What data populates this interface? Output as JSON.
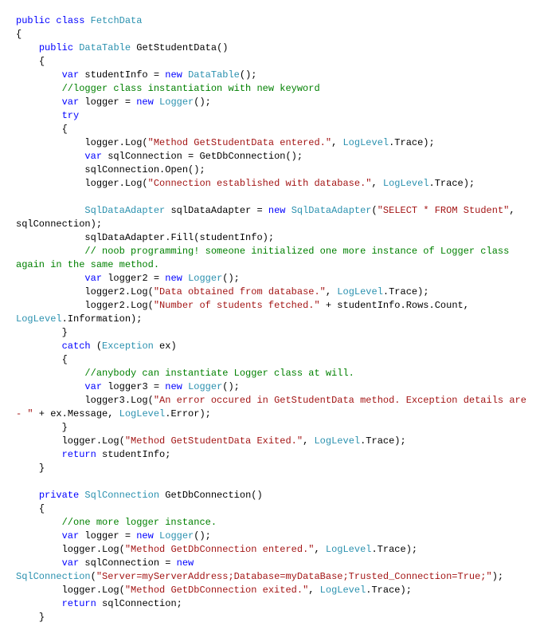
{
  "editor": {
    "language": "csharp",
    "background_color": "#FFFFFF",
    "font_size_px": 12,
    "line_height_px": 17,
    "word_wrap": true,
    "palette": {
      "keyword": "#0000FF",
      "type": "#2B91AF",
      "string": "#A31515",
      "comment": "#008000",
      "plain": "#000000"
    }
  },
  "code": {
    "lines": [
      [
        {
          "t": "kw",
          "s": "public "
        },
        {
          "t": "kw",
          "s": "class "
        },
        {
          "t": "typ",
          "s": "FetchData"
        }
      ],
      [
        {
          "t": "pln",
          "s": "{"
        }
      ],
      [
        {
          "t": "pln",
          "s": "    "
        },
        {
          "t": "kw",
          "s": "public "
        },
        {
          "t": "typ",
          "s": "DataTable "
        },
        {
          "t": "pln",
          "s": "GetStudentData()"
        }
      ],
      [
        {
          "t": "pln",
          "s": "    {"
        }
      ],
      [
        {
          "t": "pln",
          "s": "        "
        },
        {
          "t": "kw",
          "s": "var "
        },
        {
          "t": "pln",
          "s": "studentInfo = "
        },
        {
          "t": "kw",
          "s": "new "
        },
        {
          "t": "typ",
          "s": "DataTable"
        },
        {
          "t": "pln",
          "s": "();"
        }
      ],
      [
        {
          "t": "pln",
          "s": "        "
        },
        {
          "t": "cmt",
          "s": "//logger class instantiation with new keyword"
        }
      ],
      [
        {
          "t": "pln",
          "s": "        "
        },
        {
          "t": "kw",
          "s": "var "
        },
        {
          "t": "pln",
          "s": "logger = "
        },
        {
          "t": "kw",
          "s": "new "
        },
        {
          "t": "typ",
          "s": "Logger"
        },
        {
          "t": "pln",
          "s": "();"
        }
      ],
      [
        {
          "t": "pln",
          "s": "        "
        },
        {
          "t": "kw",
          "s": "try"
        }
      ],
      [
        {
          "t": "pln",
          "s": "        {"
        }
      ],
      [
        {
          "t": "pln",
          "s": "            logger.Log("
        },
        {
          "t": "str",
          "s": "\"Method GetStudentData entered.\""
        },
        {
          "t": "pln",
          "s": ", "
        },
        {
          "t": "typ",
          "s": "LogLevel"
        },
        {
          "t": "pln",
          "s": ".Trace);"
        }
      ],
      [
        {
          "t": "pln",
          "s": "            "
        },
        {
          "t": "kw",
          "s": "var "
        },
        {
          "t": "pln",
          "s": "sqlConnection = GetDbConnection();"
        }
      ],
      [
        {
          "t": "pln",
          "s": "            sqlConnection.Open();"
        }
      ],
      [
        {
          "t": "pln",
          "s": "            logger.Log("
        },
        {
          "t": "str",
          "s": "\"Connection established with database.\""
        },
        {
          "t": "pln",
          "s": ", "
        },
        {
          "t": "typ",
          "s": "LogLevel"
        },
        {
          "t": "pln",
          "s": ".Trace);"
        }
      ],
      [],
      [
        {
          "t": "pln",
          "s": "            "
        },
        {
          "t": "typ",
          "s": "SqlDataAdapter "
        },
        {
          "t": "pln",
          "s": "sqlDataAdapter = "
        },
        {
          "t": "kw",
          "s": "new "
        },
        {
          "t": "typ",
          "s": "SqlDataAdapter"
        },
        {
          "t": "pln",
          "s": "("
        },
        {
          "t": "str",
          "s": "\"SELECT * FROM Student\""
        },
        {
          "t": "pln",
          "s": ", sqlConnection);"
        }
      ],
      [
        {
          "t": "pln",
          "s": "            sqlDataAdapter.Fill(studentInfo);"
        }
      ],
      [
        {
          "t": "pln",
          "s": "            "
        },
        {
          "t": "cmt",
          "s": "// noob programming! someone initialized one more instance of Logger class again in the same method."
        }
      ],
      [
        {
          "t": "pln",
          "s": "            "
        },
        {
          "t": "kw",
          "s": "var "
        },
        {
          "t": "pln",
          "s": "logger2 = "
        },
        {
          "t": "kw",
          "s": "new "
        },
        {
          "t": "typ",
          "s": "Logger"
        },
        {
          "t": "pln",
          "s": "();"
        }
      ],
      [
        {
          "t": "pln",
          "s": "            logger2.Log("
        },
        {
          "t": "str",
          "s": "\"Data obtained from database.\""
        },
        {
          "t": "pln",
          "s": ", "
        },
        {
          "t": "typ",
          "s": "LogLevel"
        },
        {
          "t": "pln",
          "s": ".Trace);"
        }
      ],
      [
        {
          "t": "pln",
          "s": "            logger2.Log("
        },
        {
          "t": "str",
          "s": "\"Number of students fetched.\""
        },
        {
          "t": "pln",
          "s": " + studentInfo.Rows.Count, "
        },
        {
          "t": "typ",
          "s": "LogLevel"
        },
        {
          "t": "pln",
          "s": ".Information);"
        }
      ],
      [
        {
          "t": "pln",
          "s": "        }"
        }
      ],
      [
        {
          "t": "pln",
          "s": "        "
        },
        {
          "t": "kw",
          "s": "catch "
        },
        {
          "t": "pln",
          "s": "("
        },
        {
          "t": "typ",
          "s": "Exception "
        },
        {
          "t": "pln",
          "s": "ex)"
        }
      ],
      [
        {
          "t": "pln",
          "s": "        {"
        }
      ],
      [
        {
          "t": "pln",
          "s": "            "
        },
        {
          "t": "cmt",
          "s": "//anybody can instantiate Logger class at will."
        }
      ],
      [
        {
          "t": "pln",
          "s": "            "
        },
        {
          "t": "kw",
          "s": "var "
        },
        {
          "t": "pln",
          "s": "logger3 = "
        },
        {
          "t": "kw",
          "s": "new "
        },
        {
          "t": "typ",
          "s": "Logger"
        },
        {
          "t": "pln",
          "s": "();"
        }
      ],
      [
        {
          "t": "pln",
          "s": "            logger3.Log("
        },
        {
          "t": "str",
          "s": "\"An error occured in GetStudentData method. Exception details are - \""
        },
        {
          "t": "pln",
          "s": " + ex.Message, "
        },
        {
          "t": "typ",
          "s": "LogLevel"
        },
        {
          "t": "pln",
          "s": ".Error);"
        }
      ],
      [
        {
          "t": "pln",
          "s": "        }"
        }
      ],
      [
        {
          "t": "pln",
          "s": "        logger.Log("
        },
        {
          "t": "str",
          "s": "\"Method GetStudentData Exited.\""
        },
        {
          "t": "pln",
          "s": ", "
        },
        {
          "t": "typ",
          "s": "LogLevel"
        },
        {
          "t": "pln",
          "s": ".Trace);"
        }
      ],
      [
        {
          "t": "pln",
          "s": "        "
        },
        {
          "t": "kw",
          "s": "return "
        },
        {
          "t": "pln",
          "s": "studentInfo;"
        }
      ],
      [
        {
          "t": "pln",
          "s": "    }"
        }
      ],
      [],
      [
        {
          "t": "pln",
          "s": "    "
        },
        {
          "t": "kw",
          "s": "private "
        },
        {
          "t": "typ",
          "s": "SqlConnection "
        },
        {
          "t": "pln",
          "s": "GetDbConnection()"
        }
      ],
      [
        {
          "t": "pln",
          "s": "    {"
        }
      ],
      [
        {
          "t": "pln",
          "s": "        "
        },
        {
          "t": "cmt",
          "s": "//one more logger instance."
        }
      ],
      [
        {
          "t": "pln",
          "s": "        "
        },
        {
          "t": "kw",
          "s": "var "
        },
        {
          "t": "pln",
          "s": "logger = "
        },
        {
          "t": "kw",
          "s": "new "
        },
        {
          "t": "typ",
          "s": "Logger"
        },
        {
          "t": "pln",
          "s": "();"
        }
      ],
      [
        {
          "t": "pln",
          "s": "        logger.Log("
        },
        {
          "t": "str",
          "s": "\"Method GetDbConnection entered.\""
        },
        {
          "t": "pln",
          "s": ", "
        },
        {
          "t": "typ",
          "s": "LogLevel"
        },
        {
          "t": "pln",
          "s": ".Trace);"
        }
      ],
      [
        {
          "t": "pln",
          "s": "        "
        },
        {
          "t": "kw",
          "s": "var "
        },
        {
          "t": "pln",
          "s": "sqlConnection = "
        },
        {
          "t": "kw",
          "s": "new "
        },
        {
          "t": "typ",
          "s": "SqlConnection"
        },
        {
          "t": "pln",
          "s": "("
        },
        {
          "t": "str",
          "s": "\"Server=myServerAddress;Database=myDataBase;Trusted_Connection=True;\""
        },
        {
          "t": "pln",
          "s": ");"
        }
      ],
      [
        {
          "t": "pln",
          "s": "        logger.Log("
        },
        {
          "t": "str",
          "s": "\"Method GetDbConnection exited.\""
        },
        {
          "t": "pln",
          "s": ", "
        },
        {
          "t": "typ",
          "s": "LogLevel"
        },
        {
          "t": "pln",
          "s": ".Trace);"
        }
      ],
      [
        {
          "t": "pln",
          "s": "        "
        },
        {
          "t": "kw",
          "s": "return "
        },
        {
          "t": "pln",
          "s": "sqlConnection;"
        }
      ],
      [
        {
          "t": "pln",
          "s": "    }"
        }
      ]
    ]
  }
}
